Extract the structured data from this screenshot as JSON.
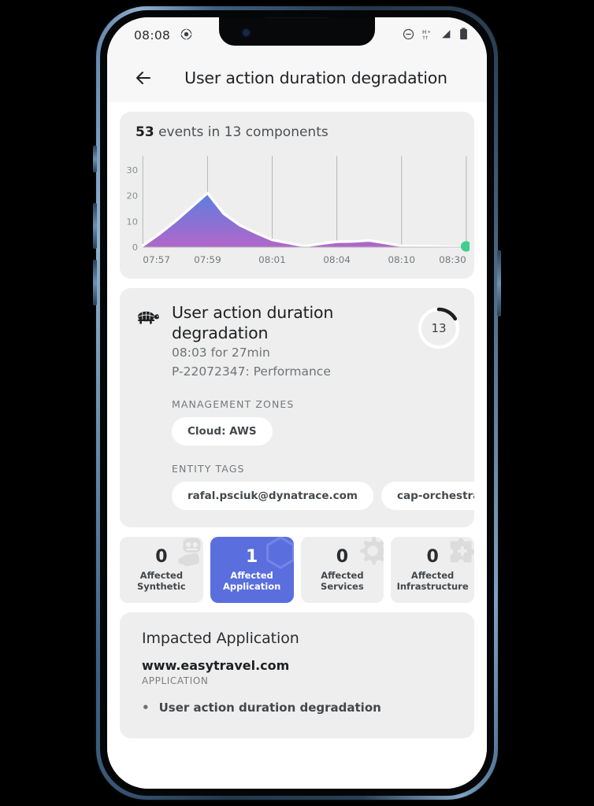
{
  "status_bar": {
    "time": "08:08",
    "icons": [
      "record-dot-icon",
      "do-not-disturb-icon",
      "hspa-plus-icon",
      "signal-icon",
      "battery-icon"
    ]
  },
  "app_bar": {
    "back_icon": "back-arrow-icon",
    "title": "User action duration degradation"
  },
  "chart_card": {
    "heading_count": "53",
    "heading_rest": " events in 13 components"
  },
  "chart_data": {
    "type": "area",
    "title": "53 events in 13 components",
    "xlabel": "",
    "ylabel": "",
    "ylim": [
      0,
      33
    ],
    "yticks": [
      0,
      10,
      20,
      30
    ],
    "ytick_labels": [
      "0",
      "10",
      "20",
      "30"
    ],
    "xtick_labels": [
      "07:57",
      "07:59",
      "08:01",
      "08:04",
      "08:10",
      "08:30"
    ],
    "xtick_positions": [
      0,
      2,
      4,
      6,
      8,
      10
    ],
    "grid": "vertical-only",
    "legend": "none",
    "x": [
      0,
      0.5,
      1,
      1.5,
      2,
      2.5,
      3,
      3.5,
      4,
      4.5,
      5,
      5.5,
      6,
      6.5,
      7,
      7.5,
      8,
      8.5,
      9,
      9.5,
      10
    ],
    "values": [
      0.6,
      5,
      10,
      15.5,
      21,
      13,
      8.5,
      5.5,
      2.8,
      1.6,
      0.4,
      1.3,
      2.1,
      2.2,
      2.6,
      1.6,
      0.5,
      0.35,
      0.3,
      0.1,
      0.0
    ],
    "area_gradient": {
      "top": "#5b7ee0",
      "bottom": "#b167c9"
    },
    "line_color": "#ffffff",
    "endpoint_marker": {
      "color": "#3ecf8e",
      "label": "08:30"
    }
  },
  "problem_card": {
    "severity_icon": "turtle-icon",
    "title": "User action duration degradation",
    "time": "08:03 for 27min",
    "id": "P-22072347: Performance",
    "progress_value": "13",
    "management_zones_label": "MANAGEMENT ZONES",
    "management_zones": [
      "Cloud: AWS"
    ],
    "entity_tags_label": "ENTITY TAGS",
    "entity_tags": [
      "rafal.psciuk@dynatrace.com",
      "cap-orchestration",
      ""
    ]
  },
  "stat_tiles": [
    {
      "value": "0",
      "label": "Affected\nSynthetic",
      "label_line1": "Affected",
      "label_line2": "Synthetic",
      "icon": "robot-icon",
      "active": false
    },
    {
      "value": "1",
      "label": "Affected\nApplication",
      "label_line1": "Affected",
      "label_line2": "Application",
      "icon": "hexagon-icon",
      "active": true
    },
    {
      "value": "0",
      "label": "Affected\nServices",
      "label_line1": "Affected",
      "label_line2": "Services",
      "icon": "gear-icon",
      "active": false
    },
    {
      "value": "0",
      "label": "Affected\nInfrastructure",
      "label_line1": "Affected",
      "label_line2": "Infrastructure",
      "icon": "puzzle-icon",
      "active": false
    }
  ],
  "impacted_card": {
    "title": "Impacted Application",
    "entity": "www.easytravel.com",
    "entity_type": "APPLICATION",
    "events": [
      "User action duration degradation"
    ]
  },
  "colors": {
    "accent": "#5b6ede",
    "card_bg": "#eeeeee",
    "screen_bg": "#ffffff",
    "status_bg": "#f7f7f7",
    "chart_top": "#5b7ee0",
    "chart_bottom": "#b167c9",
    "ok_green": "#3ecf8e"
  }
}
